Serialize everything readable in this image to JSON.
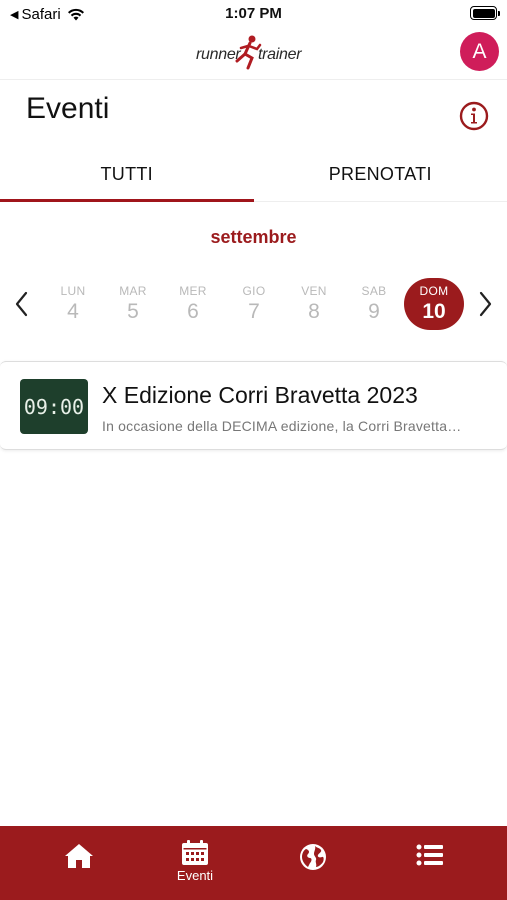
{
  "status_bar": {
    "back_app": "Safari",
    "time": "1:07 PM"
  },
  "header": {
    "logo": {
      "text_left": "runner",
      "text_right": "trainer"
    },
    "avatar_initial": "A"
  },
  "page": {
    "title": "Eventi"
  },
  "tabs": [
    {
      "label": "TUTTI",
      "active": true
    },
    {
      "label": "PRENOTATI",
      "active": false
    }
  ],
  "calendar": {
    "month": "settembre",
    "days": [
      {
        "dow": "LUN",
        "num": "4"
      },
      {
        "dow": "MAR",
        "num": "5"
      },
      {
        "dow": "MER",
        "num": "6"
      },
      {
        "dow": "GIO",
        "num": "7"
      },
      {
        "dow": "VEN",
        "num": "8"
      },
      {
        "dow": "SAB",
        "num": "9"
      },
      {
        "dow": "DOM",
        "num": "10",
        "selected": true
      }
    ]
  },
  "events": [
    {
      "time": "09:00",
      "title": "X Edizione Corri Bravetta 2023",
      "description": "In occasione della DECIMA edizione, la Corri Bravetta…"
    }
  ],
  "bottom_nav": {
    "items": [
      {
        "icon": "home-icon",
        "label": ""
      },
      {
        "icon": "calendar-icon",
        "label": "Eventi",
        "active": true
      },
      {
        "icon": "globe-icon",
        "label": ""
      },
      {
        "icon": "list-icon",
        "label": ""
      }
    ]
  },
  "colors": {
    "brand": "#9b1b1d",
    "avatar": "#cf1d5a",
    "time_badge": "#1e3f2c"
  }
}
